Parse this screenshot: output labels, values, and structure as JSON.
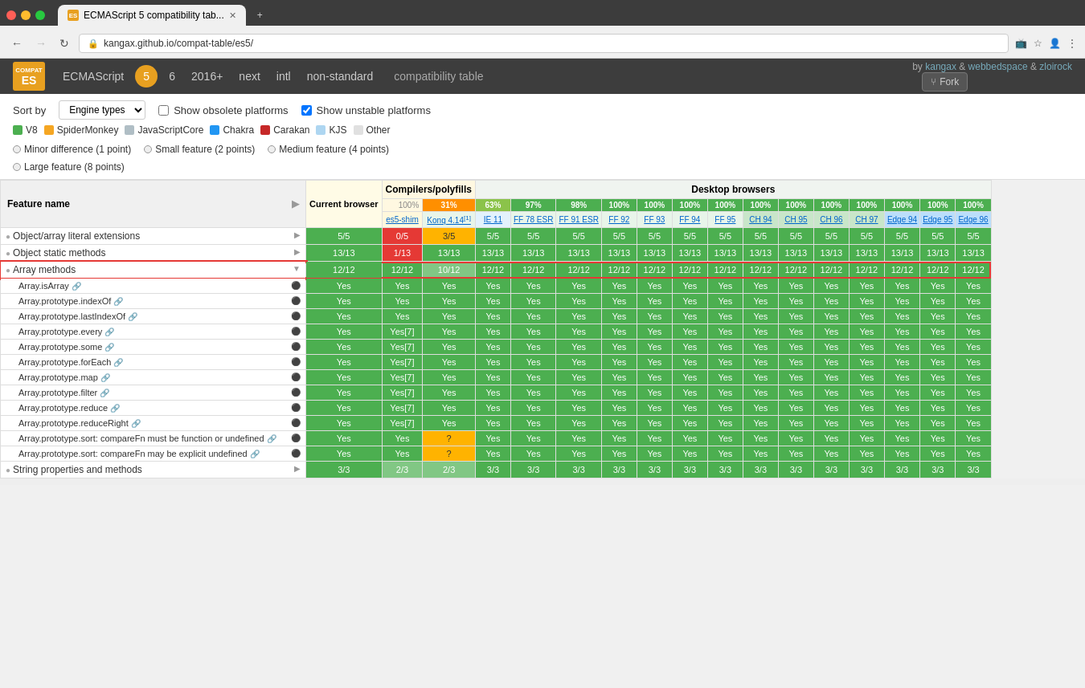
{
  "window": {
    "controls": [
      "red",
      "yellow",
      "green"
    ],
    "tab_title": "ECMAScript 5 compatibility tab...",
    "new_tab": "+",
    "address": "kangax.github.io/compat-table/es5/",
    "favicon": "ES"
  },
  "app": {
    "logo": "ES",
    "nav_items": [
      "ECMAScript",
      "5",
      "6",
      "2016+",
      "next",
      "intl",
      "non-standard"
    ],
    "title": "compatibility table",
    "authors": [
      "kangax",
      "webbedspace",
      "zloirock"
    ],
    "fork_label": "Fork"
  },
  "controls": {
    "sort_label": "Sort by",
    "sort_option": "Engine types",
    "show_obsolete_label": "Show obsolete platforms",
    "show_obsolete_checked": false,
    "show_unstable_label": "Show unstable platforms",
    "show_unstable_checked": true
  },
  "legend": {
    "items": [
      {
        "color": "#4caf50",
        "label": "V8"
      },
      {
        "color": "#f5a623",
        "label": "SpiderMonkey"
      },
      {
        "color": "#b0bec5",
        "label": "JavaScriptCore"
      },
      {
        "color": "#2196f3",
        "label": "Chakra"
      },
      {
        "color": "#c62828",
        "label": "Carakan"
      },
      {
        "color": "#aed6f1",
        "label": "KJS"
      },
      {
        "color": "#e0e0e0",
        "label": "Other"
      }
    ],
    "notes": [
      "Minor difference (1 point)",
      "Small feature (2 points)",
      "Medium feature (4 points)",
      "Large feature (8 points)"
    ]
  },
  "table": {
    "feature_col_label": "Feature name",
    "section_headers": {
      "compilers": "Compilers/polyfills",
      "desktop": "Desktop browsers"
    },
    "pct_row": {
      "total": "100%",
      "compilers": "31%",
      "ie11": "63%",
      "ff78": "97%",
      "ff91": "98%",
      "ff92_plus": "100%"
    },
    "browser_headers": [
      {
        "label": "es5-shim",
        "url": "#"
      },
      {
        "label": "Konq 4.14",
        "note": "[1]",
        "url": "#"
      },
      {
        "label": "IE 11",
        "url": "#"
      },
      {
        "label": "FF 78 ESR",
        "url": "#"
      },
      {
        "label": "FF 91 ESR",
        "url": "#"
      },
      {
        "label": "FF 92",
        "url": "#"
      },
      {
        "label": "FF 93",
        "url": "#"
      },
      {
        "label": "FF 94",
        "url": "#"
      },
      {
        "label": "FF 95",
        "url": "#"
      },
      {
        "label": "CH 94",
        "url": "#"
      },
      {
        "label": "CH 95",
        "url": "#"
      },
      {
        "label": "CH 96",
        "url": "#"
      },
      {
        "label": "CH 97",
        "url": "#"
      },
      {
        "label": "Edge 94",
        "url": "#"
      },
      {
        "label": "Edge 95",
        "url": "#"
      },
      {
        "label": "Edge 96",
        "url": "#"
      }
    ],
    "current_browser_label": "Current browser",
    "features": [
      {
        "name": "Object/array literal extensions",
        "type": "section",
        "score": "5/5",
        "current": "5/5",
        "cells": [
          "0/5",
          "3/5",
          "5/5",
          "5/5",
          "5/5",
          "5/5",
          "5/5",
          "5/5",
          "5/5",
          "5/5",
          "5/5",
          "5/5",
          "5/5",
          "5/5",
          "5/5",
          "5/5"
        ],
        "cell_types": [
          "red",
          "yellow",
          "green",
          "green",
          "green",
          "green",
          "green",
          "green",
          "green",
          "green",
          "green",
          "green",
          "green",
          "green",
          "green",
          "green"
        ]
      },
      {
        "name": "Object static methods",
        "type": "section",
        "score": "13/13",
        "current": "13/13",
        "cells": [
          "1/13",
          "13/13",
          "13/13",
          "13/13",
          "13/13",
          "13/13",
          "13/13",
          "13/13",
          "13/13",
          "13/13",
          "13/13",
          "13/13",
          "13/13",
          "13/13",
          "13/13",
          "13/13"
        ],
        "cell_types": [
          "red",
          "green",
          "green",
          "green",
          "green",
          "green",
          "green",
          "green",
          "green",
          "green",
          "green",
          "green",
          "green",
          "green",
          "green",
          "green"
        ]
      },
      {
        "name": "Array methods",
        "type": "section",
        "score": "12/12",
        "current": "12/12",
        "selected": true,
        "cells": [
          "12/12",
          "10/12",
          "12/12",
          "12/12",
          "12/12",
          "12/12",
          "12/12",
          "12/12",
          "12/12",
          "12/12",
          "12/12",
          "12/12",
          "12/12",
          "12/12",
          "12/12",
          "12/12"
        ],
        "cell_types": [
          "green",
          "light-green",
          "green",
          "green",
          "green",
          "green",
          "green",
          "green",
          "green",
          "green",
          "green",
          "green",
          "green",
          "green",
          "green",
          "green"
        ]
      },
      {
        "name": "Array.isArray",
        "type": "item",
        "current": "Yes",
        "cells": [
          "Yes",
          "Yes",
          "Yes",
          "Yes",
          "Yes",
          "Yes",
          "Yes",
          "Yes",
          "Yes",
          "Yes",
          "Yes",
          "Yes",
          "Yes",
          "Yes",
          "Yes",
          "Yes"
        ],
        "cell_types": [
          "green",
          "green",
          "green",
          "green",
          "green",
          "green",
          "green",
          "green",
          "green",
          "green",
          "green",
          "green",
          "green",
          "green",
          "green",
          "green"
        ]
      },
      {
        "name": "Array.prototype.indexOf",
        "type": "item",
        "current": "Yes",
        "cells": [
          "Yes",
          "Yes",
          "Yes",
          "Yes",
          "Yes",
          "Yes",
          "Yes",
          "Yes",
          "Yes",
          "Yes",
          "Yes",
          "Yes",
          "Yes",
          "Yes",
          "Yes",
          "Yes"
        ],
        "cell_types": [
          "green",
          "green",
          "green",
          "green",
          "green",
          "green",
          "green",
          "green",
          "green",
          "green",
          "green",
          "green",
          "green",
          "green",
          "green",
          "green"
        ]
      },
      {
        "name": "Array.prototype.lastIndexOf",
        "type": "item",
        "current": "Yes",
        "cells": [
          "Yes",
          "Yes",
          "Yes",
          "Yes",
          "Yes",
          "Yes",
          "Yes",
          "Yes",
          "Yes",
          "Yes",
          "Yes",
          "Yes",
          "Yes",
          "Yes",
          "Yes",
          "Yes"
        ],
        "cell_types": [
          "green",
          "green",
          "green",
          "green",
          "green",
          "green",
          "green",
          "green",
          "green",
          "green",
          "green",
          "green",
          "green",
          "green",
          "green",
          "green"
        ]
      },
      {
        "name": "Array.prototype.every",
        "type": "item",
        "current": "Yes",
        "cells": [
          "Yes[7]",
          "Yes",
          "Yes",
          "Yes",
          "Yes",
          "Yes",
          "Yes",
          "Yes",
          "Yes",
          "Yes",
          "Yes",
          "Yes",
          "Yes",
          "Yes",
          "Yes",
          "Yes"
        ],
        "cell_types": [
          "green",
          "green",
          "green",
          "green",
          "green",
          "green",
          "green",
          "green",
          "green",
          "green",
          "green",
          "green",
          "green",
          "green",
          "green",
          "green"
        ]
      },
      {
        "name": "Array.prototype.some",
        "type": "item",
        "current": "Yes",
        "cells": [
          "Yes[7]",
          "Yes",
          "Yes",
          "Yes",
          "Yes",
          "Yes",
          "Yes",
          "Yes",
          "Yes",
          "Yes",
          "Yes",
          "Yes",
          "Yes",
          "Yes",
          "Yes",
          "Yes"
        ],
        "cell_types": [
          "green",
          "green",
          "green",
          "green",
          "green",
          "green",
          "green",
          "green",
          "green",
          "green",
          "green",
          "green",
          "green",
          "green",
          "green",
          "green"
        ]
      },
      {
        "name": "Array.prototype.forEach",
        "type": "item",
        "current": "Yes",
        "cells": [
          "Yes[7]",
          "Yes",
          "Yes",
          "Yes",
          "Yes",
          "Yes",
          "Yes",
          "Yes",
          "Yes",
          "Yes",
          "Yes",
          "Yes",
          "Yes",
          "Yes",
          "Yes",
          "Yes"
        ],
        "cell_types": [
          "green",
          "green",
          "green",
          "green",
          "green",
          "green",
          "green",
          "green",
          "green",
          "green",
          "green",
          "green",
          "green",
          "green",
          "green",
          "green"
        ]
      },
      {
        "name": "Array.prototype.map",
        "type": "item",
        "current": "Yes",
        "cells": [
          "Yes[7]",
          "Yes",
          "Yes",
          "Yes",
          "Yes",
          "Yes",
          "Yes",
          "Yes",
          "Yes",
          "Yes",
          "Yes",
          "Yes",
          "Yes",
          "Yes",
          "Yes",
          "Yes"
        ],
        "cell_types": [
          "green",
          "green",
          "green",
          "green",
          "green",
          "green",
          "green",
          "green",
          "green",
          "green",
          "green",
          "green",
          "green",
          "green",
          "green",
          "green"
        ]
      },
      {
        "name": "Array.prototype.filter",
        "type": "item",
        "current": "Yes",
        "cells": [
          "Yes[7]",
          "Yes",
          "Yes",
          "Yes",
          "Yes",
          "Yes",
          "Yes",
          "Yes",
          "Yes",
          "Yes",
          "Yes",
          "Yes",
          "Yes",
          "Yes",
          "Yes",
          "Yes"
        ],
        "cell_types": [
          "green",
          "green",
          "green",
          "green",
          "green",
          "green",
          "green",
          "green",
          "green",
          "green",
          "green",
          "green",
          "green",
          "green",
          "green",
          "green"
        ]
      },
      {
        "name": "Array.prototype.reduce",
        "type": "item",
        "current": "Yes",
        "cells": [
          "Yes[7]",
          "Yes",
          "Yes",
          "Yes",
          "Yes",
          "Yes",
          "Yes",
          "Yes",
          "Yes",
          "Yes",
          "Yes",
          "Yes",
          "Yes",
          "Yes",
          "Yes",
          "Yes"
        ],
        "cell_types": [
          "green",
          "green",
          "green",
          "green",
          "green",
          "green",
          "green",
          "green",
          "green",
          "green",
          "green",
          "green",
          "green",
          "green",
          "green",
          "green"
        ]
      },
      {
        "name": "Array.prototype.reduceRight",
        "type": "item",
        "current": "Yes",
        "cells": [
          "Yes[7]",
          "Yes",
          "Yes",
          "Yes",
          "Yes",
          "Yes",
          "Yes",
          "Yes",
          "Yes",
          "Yes",
          "Yes",
          "Yes",
          "Yes",
          "Yes",
          "Yes",
          "Yes"
        ],
        "cell_types": [
          "green",
          "green",
          "green",
          "green",
          "green",
          "green",
          "green",
          "green",
          "green",
          "green",
          "green",
          "green",
          "green",
          "green",
          "green",
          "green"
        ]
      },
      {
        "name": "Array.prototype.sort: compareFn must be function or undefined",
        "type": "item",
        "current": "Yes",
        "cells": [
          "Yes",
          "?",
          "Yes",
          "Yes",
          "Yes",
          "Yes",
          "Yes",
          "Yes",
          "Yes",
          "Yes",
          "Yes",
          "Yes",
          "Yes",
          "Yes",
          "Yes",
          "Yes"
        ],
        "cell_types": [
          "green",
          "yellow",
          "green",
          "green",
          "green",
          "green",
          "green",
          "green",
          "green",
          "green",
          "green",
          "green",
          "green",
          "green",
          "green",
          "green"
        ]
      },
      {
        "name": "Array.prototype.sort: compareFn may be explicit undefined",
        "type": "item",
        "current": "Yes",
        "cells": [
          "Yes",
          "?",
          "Yes",
          "Yes",
          "Yes",
          "Yes",
          "Yes",
          "Yes",
          "Yes",
          "Yes",
          "Yes",
          "Yes",
          "Yes",
          "Yes",
          "Yes",
          "Yes"
        ],
        "cell_types": [
          "green",
          "yellow",
          "green",
          "green",
          "green",
          "green",
          "green",
          "green",
          "green",
          "green",
          "green",
          "green",
          "green",
          "green",
          "green",
          "green"
        ]
      },
      {
        "name": "String properties and methods",
        "type": "section",
        "score": "3/3",
        "current": "3/3",
        "cells": [
          "2/3",
          "2/3",
          "3/3",
          "3/3",
          "3/3",
          "3/3",
          "3/3",
          "3/3",
          "3/3",
          "3/3",
          "3/3",
          "3/3",
          "3/3",
          "3/3",
          "3/3",
          "3/3"
        ],
        "cell_types": [
          "light-green",
          "light-green",
          "green",
          "green",
          "green",
          "green",
          "green",
          "green",
          "green",
          "green",
          "green",
          "green",
          "green",
          "green",
          "green",
          "green"
        ]
      }
    ]
  }
}
